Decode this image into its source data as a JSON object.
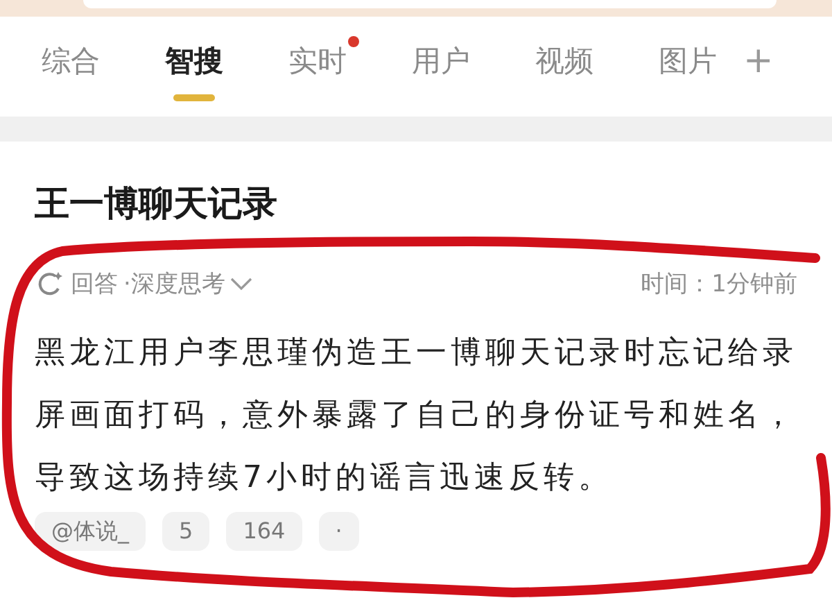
{
  "tabs": [
    {
      "label": "综合",
      "selected": false,
      "dot": false
    },
    {
      "label": "智搜",
      "selected": true,
      "dot": false
    },
    {
      "label": "实时",
      "selected": false,
      "dot": true
    },
    {
      "label": "用户",
      "selected": false,
      "dot": false
    },
    {
      "label": "视频",
      "selected": false,
      "dot": false
    },
    {
      "label": "图片",
      "selected": false,
      "dot": false
    }
  ],
  "add_tab": "+",
  "result": {
    "title": "王一博聊天记录",
    "mode": "回答",
    "mode_detail": "·深度思考",
    "time": "时间：1分钟前",
    "body": "黑龙江用户李思瑾伪造王一博聊天记录时忘记给录屏画面打码，意外暴露了自己的身份证号和姓名，导致这场持续7小时的谣言迅速反转。",
    "sources": [
      "@体说_",
      "5",
      "164",
      "·"
    ]
  }
}
